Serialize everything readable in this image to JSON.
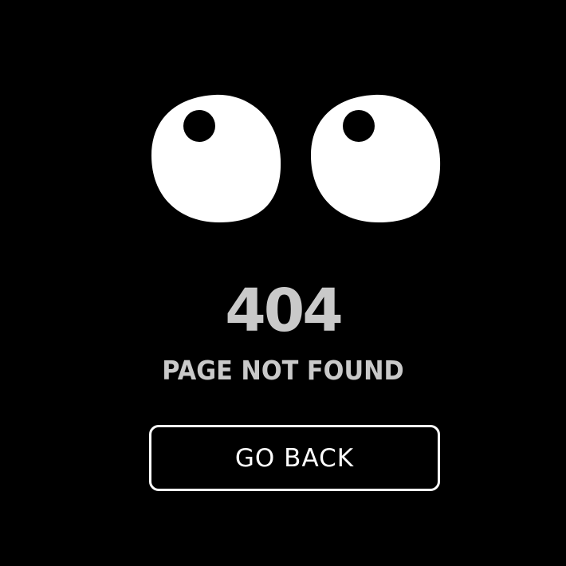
{
  "error": {
    "code": "404",
    "message": "PAGE NOT FOUND"
  },
  "actions": {
    "go_back_label": "GO BACK"
  },
  "colors": {
    "background": "#000000",
    "eye_white": "#ffffff",
    "pupil": "#000000",
    "text": "#c9c9c9",
    "button_border": "#ffffff"
  },
  "icons": {
    "eyes": "cartoon-eyes-icon"
  }
}
